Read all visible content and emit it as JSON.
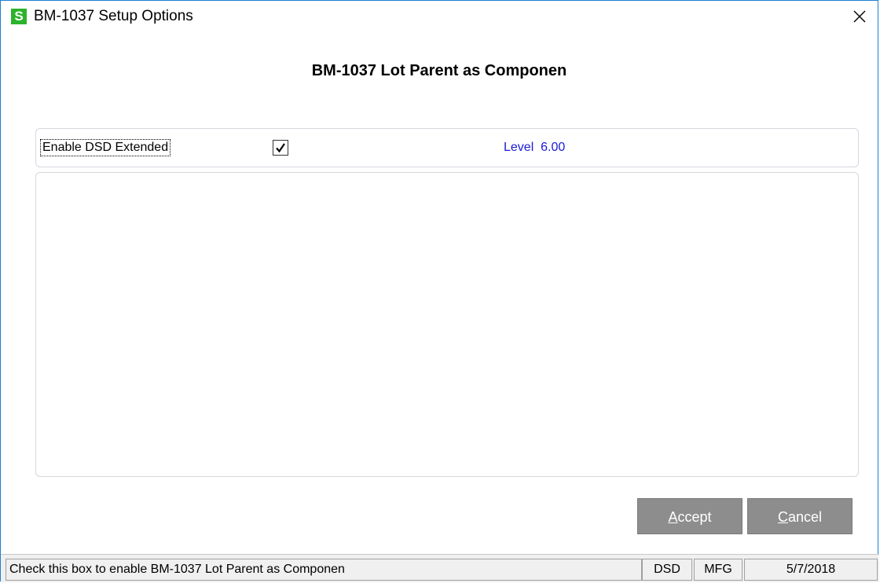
{
  "window": {
    "app_icon_letter": "S",
    "title": "BM-1037 Setup Options",
    "close_glyph": "close-icon"
  },
  "heading": "BM-1037 Lot Parent as Componen",
  "option": {
    "label": "Enable DSD Extended",
    "checked": true,
    "level_text": "Level  6.00"
  },
  "buttons": {
    "accept_mnemonic": "A",
    "accept_rest": "ccept",
    "cancel_mnemonic": "C",
    "cancel_rest": "ancel"
  },
  "status": {
    "message": "Check this box to enable BM-1037 Lot Parent as Componen",
    "dsd": "DSD",
    "mfg": "MFG",
    "date": "5/7/2018"
  },
  "colors": {
    "app_icon": "#2bb32b",
    "window_border": "#1b7fd4",
    "level_text": "#1a1ad8",
    "button_bg": "#8d8d8d"
  }
}
